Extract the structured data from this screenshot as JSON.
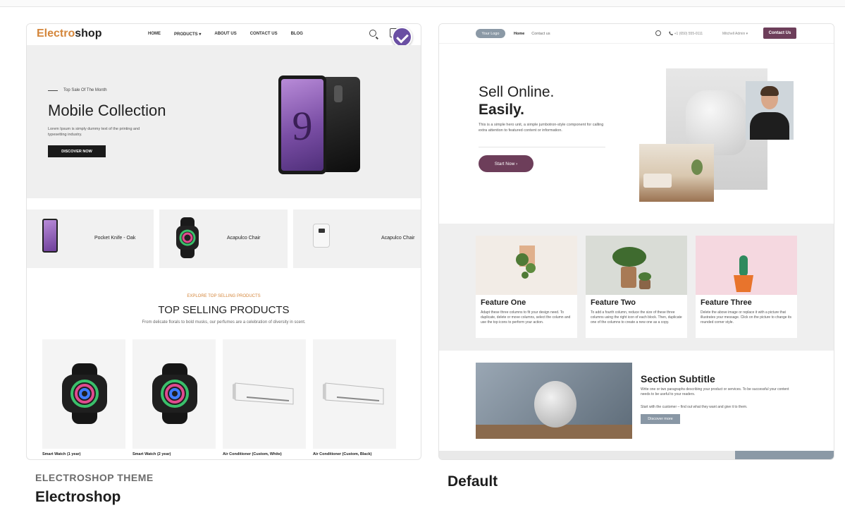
{
  "electroshop": {
    "logo_accent": "Electro",
    "logo_rest": "shop",
    "nav": [
      "HOME",
      "PRODUCTS ▾",
      "ABOUT US",
      "CONTACT US",
      "BLOG"
    ],
    "hero": {
      "kicker": "Top Sale Of The Month",
      "title": "Mobile Collection",
      "description": "Lorem Ipsum is simply dummy text of the printing and typesetting industry.",
      "button": "DISCOVER NOW",
      "phone_numeral": "9"
    },
    "tiles": [
      "Pocket Knife - Oak",
      "Acapulco Chair",
      "Acapulco Chair"
    ],
    "section": {
      "explore": "EXPLORE TOP SELLING PRODUCTS",
      "title": "TOP SELLING PRODUCTS",
      "subtitle": "From delicate florals to bold musks, our perfumes are a celebration of diversity in scent."
    },
    "products": [
      "Smart Watch (1 year)",
      "Smart Watch (2 year)",
      "Air Conditioner (Custom, White)",
      "Air Conditioner (Custom, Black)"
    ],
    "selected_badge": "check-icon"
  },
  "default_theme": {
    "logo": "Your Logo",
    "nav": [
      "Home",
      "Contact us"
    ],
    "phone": "📞  +1 (650) 555-0111",
    "user": "Mitchell Admin ▾",
    "contact_button": "Contact Us",
    "hero": {
      "title_line1": "Sell Online.",
      "title_line2": "Easily.",
      "description": "This is a simple hero unit, a simple jumbotron-style component for calling extra attention to featured content or information.",
      "button": "Start Now  ›"
    },
    "features": [
      {
        "title": "Feature One",
        "text": "Adapt these three columns to fit your design need. To duplicate, delete or move columns, select the column and use the top icons to perform your action."
      },
      {
        "title": "Feature Two",
        "text": "To add a fourth column, reduce the size of these three columns using the right icon of each block. Then, duplicate one of the columns to create a new one as a copy."
      },
      {
        "title": "Feature Three",
        "text": "Delete the above image or replace it with a picture that illustrates your message. Click on the picture to change its rounded corner style."
      }
    ],
    "section": {
      "title": "Section Subtitle",
      "paragraph1": "Write one or two paragraphs describing your product or services. To be successful your content needs to be useful to your readers.",
      "paragraph2": "Start with the customer – find out what they want and give it to them.",
      "button": "Discover more"
    }
  },
  "captions": {
    "left_kicker": "ELECTROSHOP THEME",
    "left_title": "Electroshop",
    "right_title": "Default"
  },
  "colors": {
    "electroshop_accent": "#d4863b",
    "default_accent": "#6d3e5a",
    "badge": "#6a4fa3"
  }
}
